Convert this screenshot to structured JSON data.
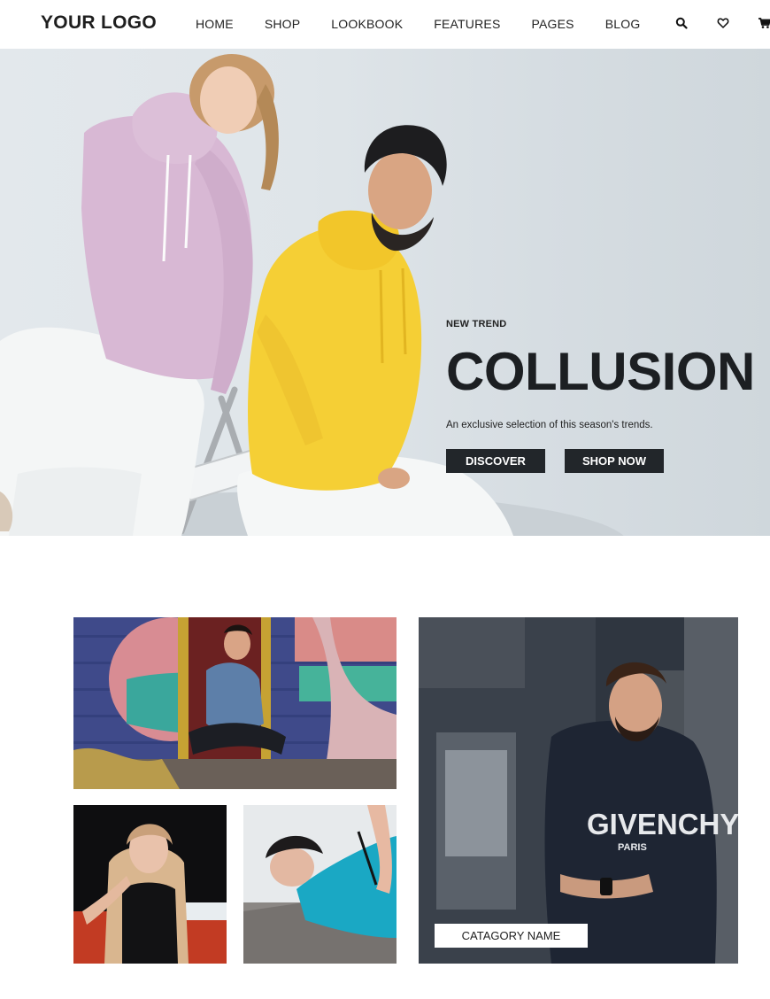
{
  "header": {
    "logo": "YOUR LOGO",
    "nav": [
      "HOME",
      "SHOP",
      "LOOKBOOK",
      "FEATURES",
      "PAGES",
      "BLOG"
    ],
    "icons": [
      "search-icon",
      "heart-icon",
      "cart-icon"
    ]
  },
  "hero": {
    "eyebrow": "NEW TREND",
    "title": "COLLUSION",
    "subtitle": "An exclusive selection of this season's trends.",
    "buttons": {
      "discover": "DISCOVER",
      "shop_now": "SHOP NOW"
    }
  },
  "categories": {
    "label": "CATAGORY NAME",
    "sweatshirt_brand": "GIVENCHY",
    "sweatshirt_city": "PARIS"
  },
  "colors": {
    "dark_button": "#22262a",
    "hero_background": "#dfe5e9",
    "hoodie_pink": "#d8b8d4",
    "hoodie_yellow": "#f5cf35"
  }
}
